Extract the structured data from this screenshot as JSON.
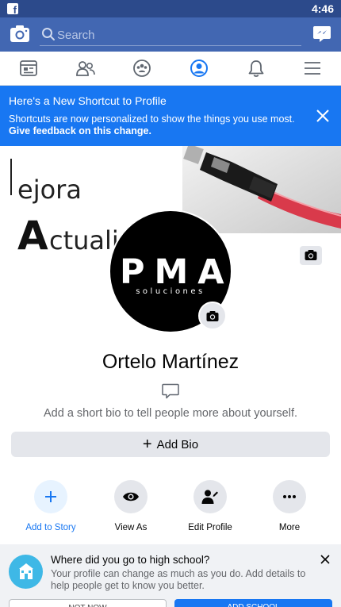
{
  "status_bar": {
    "time": "4:46",
    "app_icon": "facebook-icon"
  },
  "search": {
    "placeholder": "Search",
    "left_icon": "camera-icon",
    "right_icon": "messenger-icon"
  },
  "tabs": [
    {
      "icon": "news-feed-icon",
      "active": false
    },
    {
      "icon": "friends-icon",
      "active": false
    },
    {
      "icon": "groups-icon",
      "active": false
    },
    {
      "icon": "profile-icon",
      "active": true
    },
    {
      "icon": "notifications-icon",
      "active": false
    },
    {
      "icon": "menu-icon",
      "active": false
    }
  ],
  "banner": {
    "title": "Here's a New Shortcut to Profile",
    "text": "Shortcuts are now personalized to show the things you use most.",
    "feedback_link": "Give feedback on this change.",
    "color": "#1877f2"
  },
  "cover": {
    "line1": "ejora",
    "line2_big": "A",
    "line2_rest": "ctuali"
  },
  "avatar": {
    "main_text": "PMA",
    "sub_text": "soluciones"
  },
  "profile": {
    "name": "Ortelo Martínez",
    "bio_prompt": "Add a short bio to tell people more about yourself.",
    "add_bio_label": "Add Bio"
  },
  "actions": [
    {
      "label": "Add to Story",
      "icon": "plus-icon"
    },
    {
      "label": "View As",
      "icon": "eye-icon"
    },
    {
      "label": "Edit Profile",
      "icon": "edit-profile-icon"
    },
    {
      "label": "More",
      "icon": "more-icon"
    }
  ],
  "suggestion": {
    "title": "Where did you go to high school?",
    "text": "Your profile can change as much as you do. Add details to help people get to know you better.",
    "left_button": "NOT NOW",
    "right_button": "ADD SCHOOL"
  },
  "colors": {
    "brand": "#4267b2",
    "status_bar": "#2c4a8b",
    "accent": "#1877f2"
  }
}
